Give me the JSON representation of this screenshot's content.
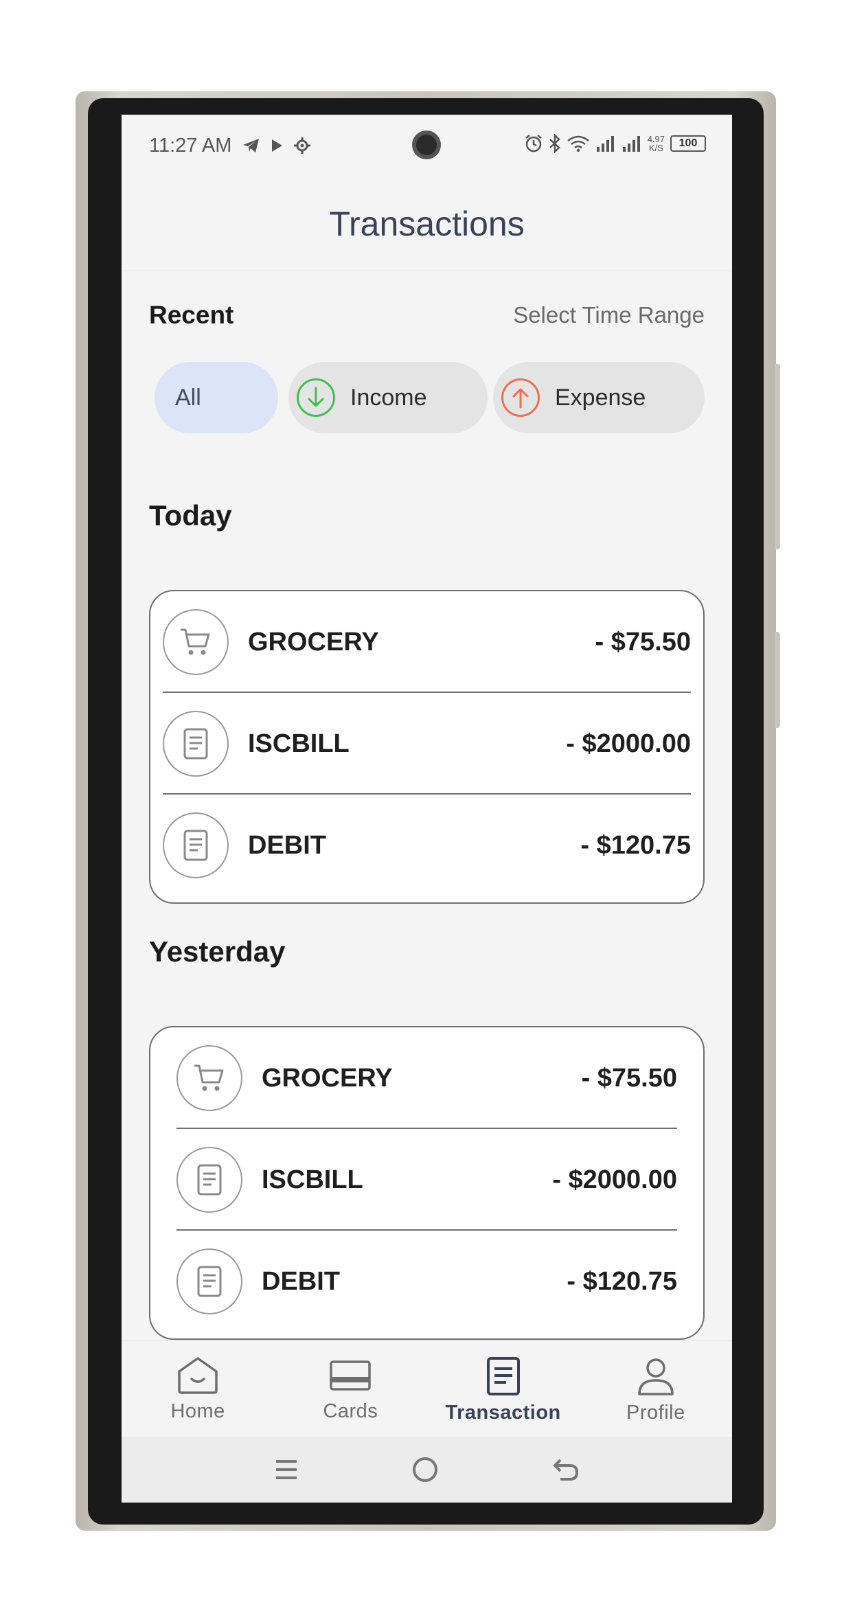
{
  "status_bar": {
    "time": "11:27 AM",
    "net_speed_value": "4.97",
    "net_speed_unit": "K/S",
    "battery": "100"
  },
  "header": {
    "title": "Transactions"
  },
  "section": {
    "recent_label": "Recent",
    "time_range_label": "Select Time Range"
  },
  "filters": [
    {
      "label": "All",
      "selected": true
    },
    {
      "label": "Income",
      "icon": "arrow-down-circle-icon",
      "color": "#3fbf4f"
    },
    {
      "label": "Expense",
      "icon": "arrow-up-circle-icon",
      "color": "#ea6f55"
    }
  ],
  "groups": [
    {
      "label": "Today",
      "transactions": [
        {
          "name": "GROCERY",
          "amount": "- $75.50",
          "icon": "cart-icon"
        },
        {
          "name": "ISCBILL",
          "amount": "- $2000.00",
          "icon": "document-icon"
        },
        {
          "name": "DEBIT",
          "amount": "- $120.75",
          "icon": "document-icon"
        }
      ]
    },
    {
      "label": "Yesterday",
      "transactions": [
        {
          "name": "GROCERY",
          "amount": "- $75.50",
          "icon": "cart-icon"
        },
        {
          "name": "ISCBILL",
          "amount": "- $2000.00",
          "icon": "document-icon"
        },
        {
          "name": "DEBIT",
          "amount": "- $120.75",
          "icon": "document-icon"
        }
      ]
    }
  ],
  "bottom_nav": [
    {
      "label": "Home",
      "icon": "home-icon"
    },
    {
      "label": "Cards",
      "icon": "card-icon"
    },
    {
      "label": "Transaction",
      "icon": "transaction-icon",
      "active": true
    },
    {
      "label": "Profile",
      "icon": "profile-icon"
    }
  ],
  "colors": {
    "accent": "#3b4256",
    "chip_selected": "#dce4f7",
    "background": "#f4f4f4"
  }
}
